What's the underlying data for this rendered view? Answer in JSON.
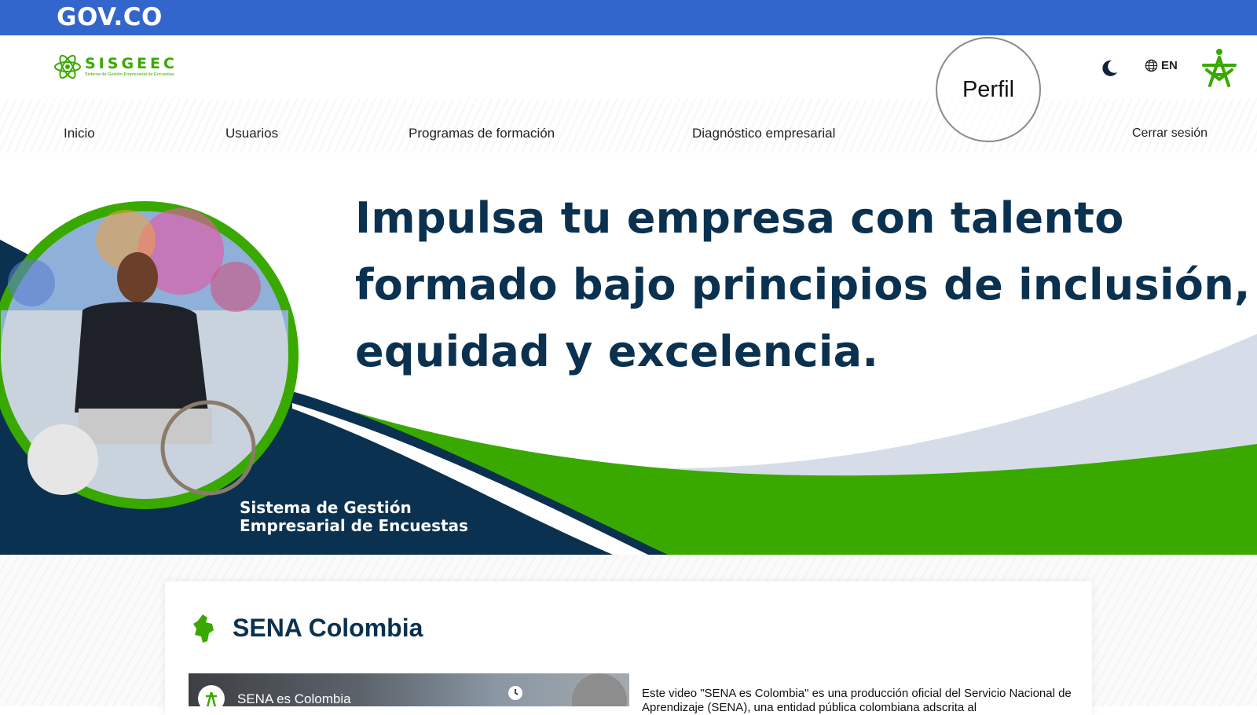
{
  "gov_bar": {
    "logo_text": "GOV.CO"
  },
  "brand": {
    "name": "SISGEEC",
    "subtitle": "Sistema de Gestión Empresarial de Encuestas"
  },
  "header": {
    "language_label": "EN"
  },
  "nav": {
    "items": [
      "Inicio",
      "Usuarios",
      "Programas de formación",
      "Diagnóstico empresarial",
      "Perfil",
      "Cerrar sesión"
    ]
  },
  "hero": {
    "headline_lines": [
      "Impulsa tu empresa con talento",
      "formado bajo principios de inclusión,",
      "equidad y excelencia."
    ],
    "caption_lines": [
      "Sistema de Gestión",
      "Empresarial de Encuestas"
    ]
  },
  "section": {
    "title": "SENA Colombia",
    "video_title": "SENA es Colombia",
    "description": "Este video \"SENA es Colombia\" es una producción oficial del Servicio Nacional de Aprendizaje (SENA), una entidad pública colombiana adscrita al"
  },
  "colors": {
    "gov_blue": "#3366cc",
    "sena_green": "#39a900",
    "navy": "#0b3150",
    "light_wave": "#d7dde8"
  },
  "icons": [
    "sisgeec-atom-icon",
    "moon-icon",
    "globe-icon",
    "sena-logo",
    "colombia-map-icon",
    "clock-icon"
  ]
}
